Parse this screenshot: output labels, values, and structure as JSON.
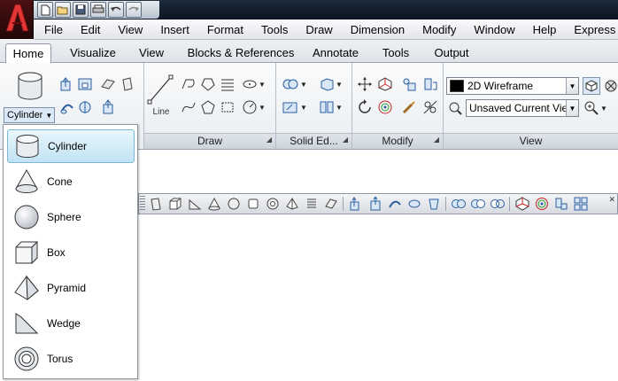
{
  "menubar": {
    "items": [
      "File",
      "Edit",
      "View",
      "Insert",
      "Format",
      "Tools",
      "Draw",
      "Dimension",
      "Modify",
      "Window",
      "Help",
      "Express"
    ]
  },
  "ribbon_tabs": {
    "items": [
      "Home",
      "Visualize",
      "View",
      "Blocks & References",
      "Annotate",
      "Tools",
      "Output"
    ],
    "active": "Home"
  },
  "ribbon": {
    "modeling": {
      "current_primitive": "Cylinder"
    },
    "draw": {
      "title": "Draw",
      "line_label": "Line"
    },
    "solid_editing": {
      "title": "Solid Ed..."
    },
    "modify": {
      "title": "Modify"
    },
    "view": {
      "title": "View",
      "visual_style": "2D Wireframe",
      "named_view": "Unsaved Current Vie"
    }
  },
  "primitive_menu": {
    "items": [
      {
        "label": "Cylinder",
        "icon": "cylinder-icon",
        "selected": true
      },
      {
        "label": "Cone",
        "icon": "cone-icon"
      },
      {
        "label": "Sphere",
        "icon": "sphere-icon"
      },
      {
        "label": "Box",
        "icon": "box-icon"
      },
      {
        "label": "Pyramid",
        "icon": "pyramid-icon"
      },
      {
        "label": "Wedge",
        "icon": "wedge-icon"
      },
      {
        "label": "Torus",
        "icon": "torus-icon"
      }
    ]
  },
  "colors": {
    "accent": "#c1e3f3",
    "app_button": "#b01d1d",
    "title_bar": "#15212f"
  }
}
